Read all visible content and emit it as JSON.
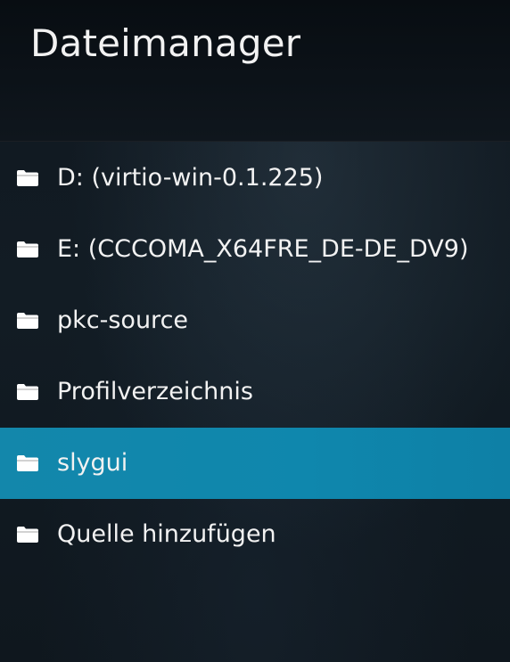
{
  "header": {
    "title": "Dateimanager"
  },
  "list": {
    "items": [
      {
        "label": "D: (virtio-win-0.1.225)",
        "icon": "folder-icon",
        "selected": false
      },
      {
        "label": "E: (CCCOMA_X64FRE_DE-DE_DV9)",
        "icon": "folder-icon",
        "selected": false
      },
      {
        "label": "pkc-source",
        "icon": "folder-icon",
        "selected": false
      },
      {
        "label": "Profilverzeichnis",
        "icon": "folder-icon",
        "selected": false
      },
      {
        "label": "slygui",
        "icon": "folder-icon",
        "selected": true
      },
      {
        "label": "Quelle hinzufügen",
        "icon": "folder-icon",
        "selected": false
      }
    ]
  },
  "colors": {
    "selection": "#1187ab",
    "text": "#f2f2f2",
    "background": "#111a22"
  }
}
